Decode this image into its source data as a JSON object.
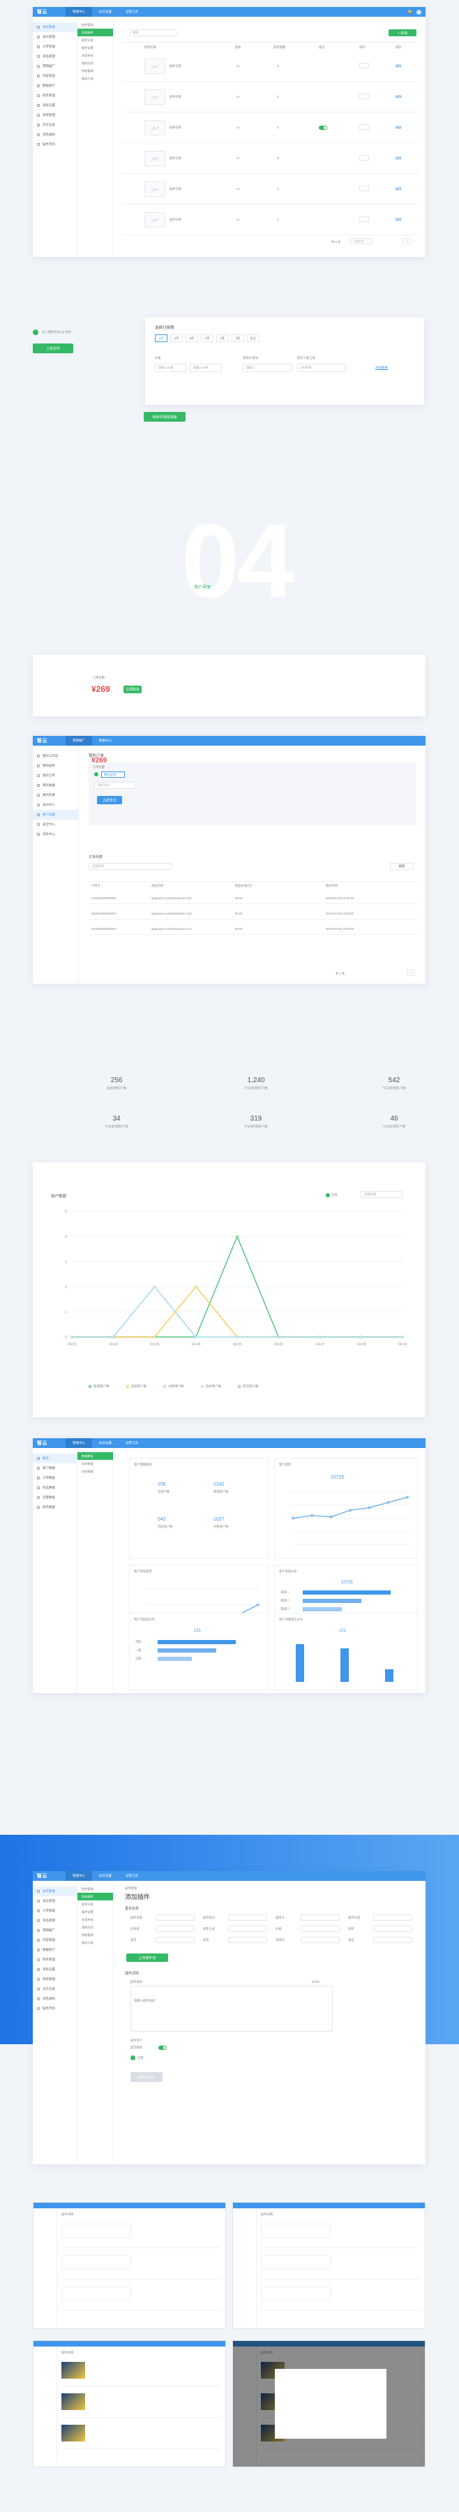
{
  "brand": {
    "logo": "智云",
    "accent": "#3f96ea",
    "green": "#35b964"
  },
  "nav": {
    "tabs1": [
      "管理中心",
      "站点设置",
      "运营工具"
    ],
    "tabs2": [
      "营销推广",
      "数据中心"
    ],
    "tabs3": [
      "管理中心",
      "站点设置",
      "运营工具"
    ],
    "tabs4": [
      "管理中心",
      "站点设置",
      "运营工具"
    ]
  },
  "sidebar1": [
    "站点管理",
    "会员管理",
    "订单管理",
    "商品管理",
    "营销推广",
    "内容管理",
    "数据统计",
    "财务管理",
    "系统设置",
    "权限管理",
    "日志记录",
    "消息通知",
    "插件市场"
  ],
  "subnav1": [
    "插件管理",
    "添加插件",
    "插件分类",
    "插件设置",
    "应用市场",
    "我的应用",
    "授权管理",
    "服务订阅"
  ],
  "panel1": {
    "search_placeholder": "搜索",
    "add_btn": "+ 添加",
    "headers": [
      "插件名称",
      "版本",
      "安装数量",
      "状态",
      "排序",
      "操作"
    ],
    "rows": [
      {
        "name": "插件名称",
        "ver": "v1",
        "count": "0",
        "op": "编辑"
      },
      {
        "name": "插件名称",
        "ver": "v1",
        "count": "0",
        "op": "编辑"
      },
      {
        "name": "插件名称",
        "ver": "v1",
        "count": "0",
        "op": "编辑"
      },
      {
        "name": "插件名称",
        "ver": "v1",
        "count": "0",
        "op": "编辑"
      },
      {
        "name": "插件名称",
        "ver": "v1",
        "count": "0",
        "op": "编辑"
      },
      {
        "name": "插件名称",
        "ver": "v1",
        "count": "0",
        "op": "编辑"
      }
    ],
    "pager": [
      "共 6 条",
      "10条/页",
      "1"
    ]
  },
  "popup": {
    "check_label": "导入插件包到 zip 文件",
    "upload_btn": "上传文件",
    "cycle_title": "选择付费期",
    "cycles": [
      "1月",
      "3月",
      "6月",
      "1年",
      "2年",
      "3年",
      "永久"
    ],
    "price_label": "价格",
    "original_label": "划线价/原价",
    "limit_label": "购买人数上限",
    "price_ph": "请输入价格",
    "unit": "元",
    "original_ph": "请输入",
    "limit_ph": "0为不限",
    "link_text": "添加规格",
    "save_btn": "保存并添加规格"
  },
  "section": {
    "number": "04",
    "label": "用户界面"
  },
  "order_card": {
    "title": "订单金额",
    "amount": "¥269",
    "btn": "立即购买"
  },
  "panel2": {
    "sidebar": [
      "我的工作台",
      "我的插件",
      "我的订单",
      "我的收藏",
      "我的优惠",
      "会员中心",
      "账户设置",
      "安全中心",
      "消息中心"
    ],
    "title": "我的订单",
    "amount_label": "订单金额",
    "amount": "¥269",
    "pay_method": "微信支付",
    "pay_note": "扫码支付",
    "pay_btn": "立即支付",
    "list_title": "订单列表",
    "filter_ph": "全部状态",
    "search_btn": "搜索",
    "headers": [
      "订单号",
      "商品名称",
      "商品价格(元)",
      "购买时间"
    ],
    "rows": [
      {
        "no": "201904050000001",
        "name": "appname.combinedname.com",
        "price": "99.00",
        "time": "2019-04-05 12:00:00"
      },
      {
        "no": "201904050000002",
        "name": "appname.combinedname.com",
        "price": "99.00",
        "time": "2019-04-05 12:00:00"
      },
      {
        "no": "201904050000003",
        "name": "appname.combinedname.com",
        "price": "99.00",
        "time": "2019-04-05 12:00:00"
      }
    ],
    "pager": [
      "共 3 条",
      "1"
    ]
  },
  "stats": [
    {
      "value": "256",
      "label": "总新增客户数"
    },
    {
      "value": "1,240",
      "label": "今日新增客户数"
    },
    {
      "value": "542",
      "label": "今日新增客户数"
    },
    {
      "value": "34",
      "label": "今日新增客户数"
    },
    {
      "value": "319",
      "label": "今日新增客户数"
    },
    {
      "value": "46",
      "label": "今日新增客户数"
    }
  ],
  "chart_main": {
    "title": "用户数据",
    "legend_switch": "全部",
    "date_ph": "选择日期",
    "legend": [
      "新增用户数",
      "活跃用户数",
      "付费用户数",
      "流失用户数",
      "回流用户数"
    ],
    "chart_data": {
      "type": "line",
      "categories": [
        "04-01",
        "04-02",
        "04-03",
        "04-04",
        "04-05",
        "04-06",
        "04-07",
        "04-08",
        "04-09"
      ],
      "ylim": [
        0,
        5
      ],
      "yticks": [
        "5",
        "4",
        "3",
        "2",
        "1",
        "0"
      ],
      "series": [
        {
          "name": "新增用户数",
          "color": "#35b964",
          "values": [
            0,
            0,
            0,
            0,
            4,
            0,
            0,
            0,
            0
          ]
        },
        {
          "name": "活跃用户数",
          "color": "#f5c342",
          "values": [
            0,
            0,
            0,
            2,
            0,
            0,
            0,
            0,
            0
          ]
        },
        {
          "name": "付费用户数",
          "color": "#8fd3e8",
          "values": [
            0,
            0,
            2,
            0,
            0,
            0,
            0,
            0,
            0
          ]
        }
      ]
    }
  },
  "dashboard": {
    "tabs": [
      "管理中心",
      "站点设置",
      "运营工具"
    ],
    "sidebar": [
      "概览",
      "客户数据",
      "订单数据",
      "商品数据",
      "流量数据",
      "财务数据"
    ],
    "subnav": [
      "数据概览",
      "实时数据",
      "历史数据"
    ],
    "card1_title": "客户数据概览",
    "card1_vals": [
      {
        "v": "256",
        "l": "总客户数"
      },
      {
        "v": "1240",
        "l": "新增客户数"
      },
      {
        "v": "542",
        "l": "活跃客户数"
      },
      {
        "v": "1027",
        "l": "付费客户数"
      }
    ],
    "card2_title": "客户趋势",
    "card2_big": "10725",
    "card3_title": "客户增长趋势",
    "card4_title": "客户来源分布",
    "card4_big": "10725",
    "card4_bars": [
      {
        "l": "来源一",
        "v": 0.9
      },
      {
        "l": "来源二",
        "v": 0.6
      },
      {
        "l": "来源三",
        "v": 0.4
      }
    ],
    "card5_title": "用户活跃度分布",
    "card5_big": "121",
    "card5_bars": [
      {
        "l": "活跃",
        "v": 0.8
      },
      {
        "l": "一般",
        "v": 0.6
      },
      {
        "l": "沉默",
        "v": 0.35
      }
    ],
    "card6_title": "用户消费频次分布",
    "card6_big": "121",
    "card6_bars": [
      0.9,
      0.8,
      0.3
    ],
    "trend_values": [
      2,
      2.2,
      2.1,
      2.6,
      2.8,
      3.2,
      3.6
    ],
    "growth_values": [
      1,
      1.4,
      1.2,
      1.8,
      1.6,
      2.4,
      3
    ]
  },
  "add_form": {
    "tabs": [
      "管理中心",
      "站点设置",
      "运营工具"
    ],
    "breadcrumb": "插件管理",
    "title": "添加插件",
    "basic_title": "基本信息",
    "fields": [
      "插件名称",
      "插件标识",
      "版本号",
      "插件分类",
      "开发者",
      "联系方式",
      "价格",
      "排序",
      "类型",
      "标签",
      "关键词",
      "状态"
    ],
    "upload_btn": "上传插件包",
    "detail_title": "插件详情",
    "desc_label": "插件描述",
    "desc_ph": "请输入插件描述",
    "counter": "0/200",
    "intro_label": "插件简介",
    "option1": "是否推荐",
    "option2": "启用",
    "submit": "保存并提交"
  },
  "thumbs": {
    "label": "插件详情"
  }
}
